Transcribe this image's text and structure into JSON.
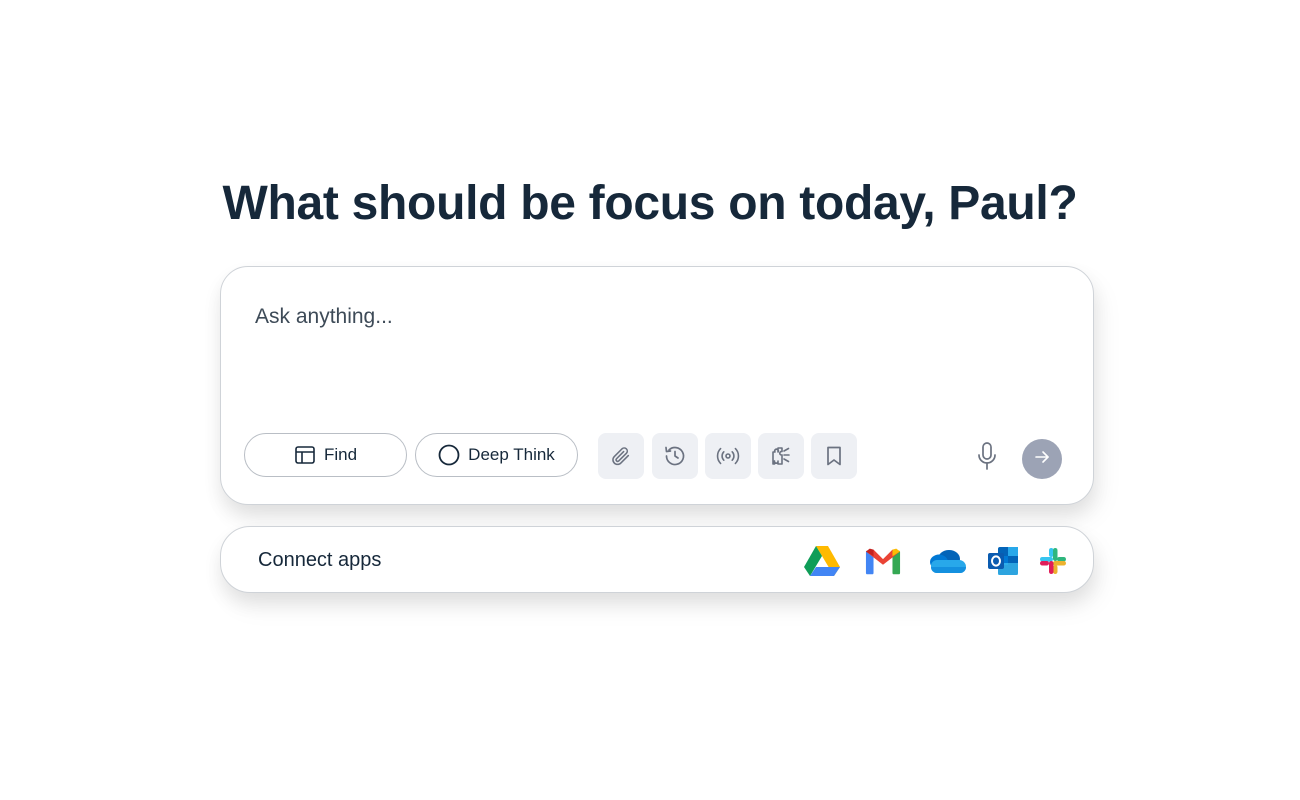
{
  "headline": "What should be focus on today, Paul?",
  "composer": {
    "placeholder": "Ask anything...",
    "find_label": "Find",
    "deep_think_label": "Deep Think",
    "tools": [
      {
        "icon": "paperclip-icon"
      },
      {
        "icon": "history-icon"
      },
      {
        "icon": "broadcast-icon"
      },
      {
        "icon": "plug-icon"
      },
      {
        "icon": "bookmark-icon"
      }
    ],
    "mic_icon": "microphone-icon",
    "send_icon": "arrow-right-icon"
  },
  "connect": {
    "label": "Connect apps",
    "apps": [
      {
        "icon": "google-drive-icon"
      },
      {
        "icon": "gmail-icon"
      },
      {
        "icon": "onedrive-icon"
      },
      {
        "icon": "outlook-icon"
      },
      {
        "icon": "slack-icon"
      }
    ]
  },
  "colors": {
    "text": "#16283a",
    "tool_bg": "#eef0f4",
    "send_bg": "#9ca3b5",
    "border": "#cfd3d8"
  }
}
